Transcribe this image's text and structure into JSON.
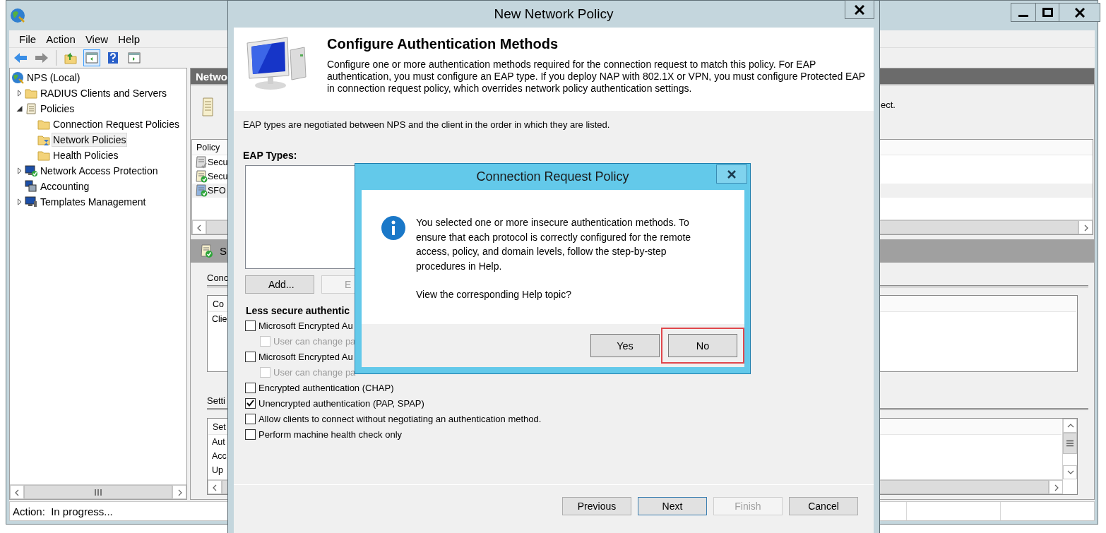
{
  "main_window": {
    "menu": [
      {
        "label": "File"
      },
      {
        "label": "Action"
      },
      {
        "label": "View"
      },
      {
        "label": "Help"
      }
    ],
    "tree": [
      {
        "label": "NPS (Local)",
        "kind": "globe",
        "expandable": false,
        "selected": false,
        "children": [
          {
            "label": "RADIUS Clients and Servers",
            "kind": "folder",
            "expandable": true,
            "expanded": false,
            "selected": false
          },
          {
            "label": "Policies",
            "kind": "scroll",
            "expandable": true,
            "expanded": true,
            "selected": false,
            "children": [
              {
                "label": "Connection Request Policies",
                "kind": "folder",
                "expandable": false,
                "selected": false
              },
              {
                "label": "Network Policies",
                "kind": "policy-folder",
                "expandable": false,
                "selected": true
              },
              {
                "label": "Health Policies",
                "kind": "folder",
                "expandable": false,
                "selected": false
              }
            ]
          },
          {
            "label": "Network Access Protection",
            "kind": "monitor-check",
            "expandable": true,
            "expanded": false,
            "selected": false
          },
          {
            "label": "Accounting",
            "kind": "computers",
            "expandable": false,
            "selected": false
          },
          {
            "label": "Templates Management",
            "kind": "monitor",
            "expandable": true,
            "expanded": false,
            "selected": false
          }
        ]
      }
    ],
    "content_header": "Netwo",
    "description_tail": "ect.",
    "policy_list": {
      "column_1": "Policy",
      "rows": [
        {
          "name": "Secu",
          "enabled": false,
          "selected": false
        },
        {
          "name": "Secu",
          "enabled": true,
          "selected": false
        },
        {
          "name": "SFO",
          "enabled": true,
          "selected": true
        }
      ]
    },
    "detail_bar": "S",
    "conditions": {
      "heading": "Conc",
      "column_1": "Co",
      "rows": [
        "Clie"
      ]
    },
    "settings": {
      "heading": "Setti",
      "column_1": "Set",
      "rows": [
        "Aut",
        "Acc",
        "Up"
      ]
    },
    "status_bar": "Action:  In progress..."
  },
  "wizard": {
    "title": "New Network Policy",
    "heading": "Configure Authentication Methods",
    "description": "Configure one or more authentication methods required for the connection request to match this policy. For EAP authentication, you must configure an EAP type. If you deploy NAP with 802.1X or VPN, you must configure Protected EAP in connection request policy, which overrides network policy authentication settings.",
    "note": "EAP types are negotiated between NPS and the client in the order in which they are listed.",
    "eap_label": "EAP Types:",
    "eap_buttons": [
      {
        "label": "Add...",
        "disabled": false
      },
      {
        "label": "E",
        "disabled": true
      }
    ],
    "section": "Less secure authentic",
    "options": [
      {
        "label": "Microsoft Encrypted Au",
        "checked": false,
        "disabled": false,
        "children": [
          {
            "label": "User can change pa",
            "checked": false,
            "disabled": true
          }
        ]
      },
      {
        "label": "Microsoft Encrypted Au",
        "checked": false,
        "disabled": false,
        "children": [
          {
            "label": "User can change pa",
            "checked": false,
            "disabled": true
          }
        ]
      },
      {
        "label": "Encrypted authentication (CHAP)",
        "checked": false,
        "disabled": false
      },
      {
        "label": "Unencrypted authentication (PAP, SPAP)",
        "checked": true,
        "disabled": false
      },
      {
        "label": "Allow clients to connect without negotiating an authentication method.",
        "checked": false,
        "disabled": false
      },
      {
        "label": "Perform machine health check only",
        "checked": false,
        "disabled": false
      }
    ],
    "buttons": [
      {
        "label": "Previous",
        "disabled": false,
        "default": false
      },
      {
        "label": "Next",
        "disabled": false,
        "default": true
      },
      {
        "label": "Finish",
        "disabled": true,
        "default": false
      },
      {
        "label": "Cancel",
        "disabled": false,
        "default": false
      }
    ]
  },
  "message_box": {
    "title": "Connection Request Policy",
    "message": "You selected one or more insecure authentication methods. To ensure that each protocol is correctly configured for the remote access, policy, and domain levels, follow the step-by-step procedures in Help.",
    "question": "View the corresponding Help topic?",
    "buttons": [
      {
        "label": "Yes",
        "highlighted": false
      },
      {
        "label": "No",
        "highlighted": true
      }
    ]
  }
}
